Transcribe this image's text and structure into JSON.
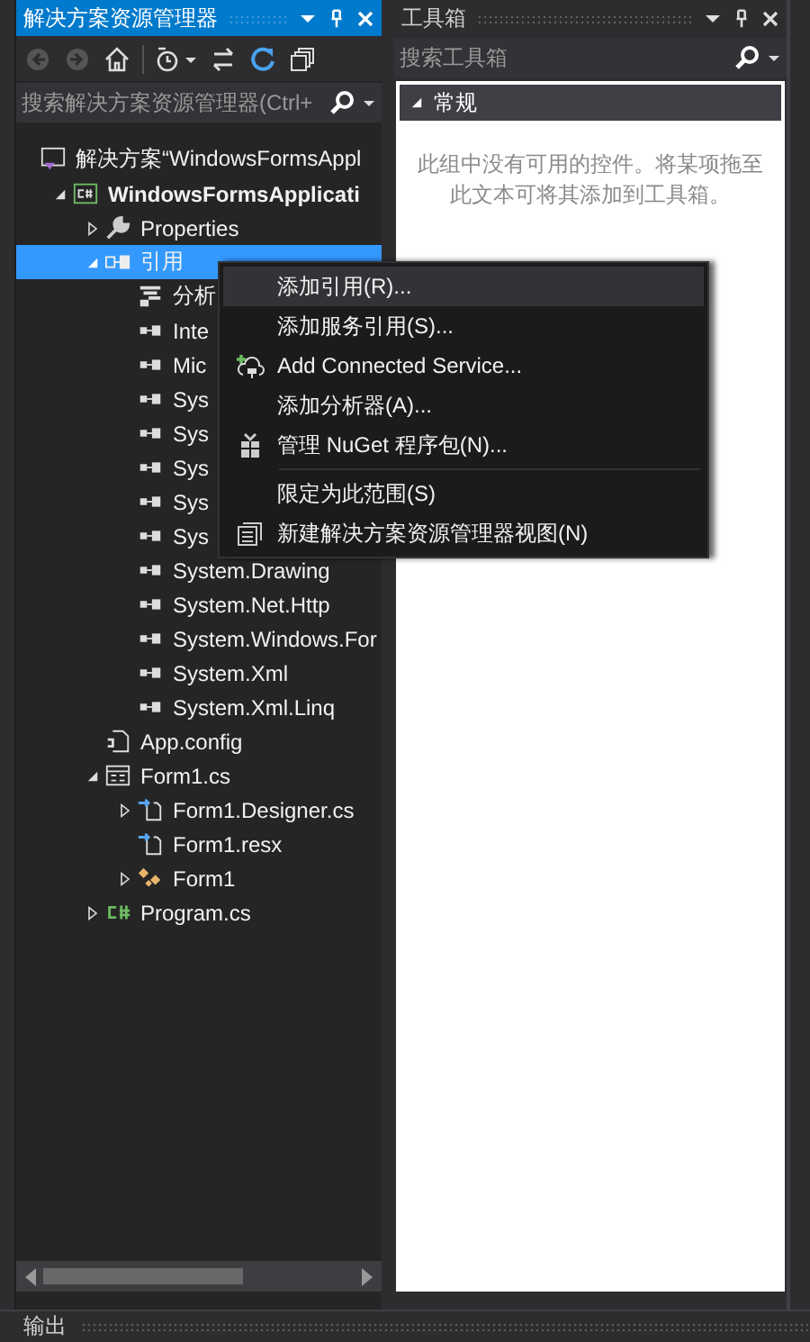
{
  "solution_explorer": {
    "title": "解决方案资源管理器",
    "search": {
      "placeholder": "搜索解决方案资源管理器(Ctrl+"
    },
    "tree": [
      {
        "label": "解决方案“WindowsFormsAppl",
        "kind": "solution",
        "selected": false,
        "children": [
          {
            "label": "WindowsFormsApplicati",
            "kind": "project",
            "expanded": true,
            "selected": false,
            "children": [
              {
                "label": "Properties",
                "kind": "properties",
                "expanded": false,
                "selected": false
              },
              {
                "label": "引用",
                "kind": "references",
                "expanded": true,
                "selected": true,
                "children": [
                  {
                    "label": "分析",
                    "kind": "analyzer",
                    "selected": false
                  },
                  {
                    "label": "Inte",
                    "kind": "assembly",
                    "selected": false
                  },
                  {
                    "label": "Mic",
                    "kind": "assembly",
                    "selected": false
                  },
                  {
                    "label": "Sys",
                    "kind": "assembly",
                    "selected": false
                  },
                  {
                    "label": "Sys",
                    "kind": "assembly",
                    "selected": false
                  },
                  {
                    "label": "Sys",
                    "kind": "assembly",
                    "selected": false
                  },
                  {
                    "label": "Sys",
                    "kind": "assembly",
                    "selected": false
                  },
                  {
                    "label": "Sys",
                    "kind": "assembly",
                    "selected": false
                  },
                  {
                    "label": "System.Drawing",
                    "kind": "assembly",
                    "selected": false
                  },
                  {
                    "label": "System.Net.Http",
                    "kind": "assembly",
                    "selected": false
                  },
                  {
                    "label": "System.Windows.For",
                    "kind": "assembly",
                    "selected": false
                  },
                  {
                    "label": "System.Xml",
                    "kind": "assembly",
                    "selected": false
                  },
                  {
                    "label": "System.Xml.Linq",
                    "kind": "assembly",
                    "selected": false
                  }
                ]
              },
              {
                "label": "App.config",
                "kind": "config",
                "selected": false
              },
              {
                "label": "Form1.cs",
                "kind": "form",
                "expanded": true,
                "selected": false,
                "children": [
                  {
                    "label": "Form1.Designer.cs",
                    "kind": "code",
                    "expanded": false,
                    "selected": false
                  },
                  {
                    "label": "Form1.resx",
                    "kind": "code",
                    "selected": false
                  },
                  {
                    "label": "Form1",
                    "kind": "class",
                    "expanded": false,
                    "selected": false
                  }
                ]
              },
              {
                "label": "Program.cs",
                "kind": "csharp",
                "expanded": false,
                "selected": false
              }
            ]
          }
        ]
      }
    ]
  },
  "context_menu": [
    {
      "kind": "plain",
      "label": "添加引用(R)...",
      "selected": true
    },
    {
      "kind": "plain",
      "label": "添加服务引用(S)...",
      "selected": false
    },
    {
      "kind": "connect",
      "label": "Add Connected Service...",
      "selected": false
    },
    {
      "kind": "plain",
      "label": "添加分析器(A)...",
      "selected": false
    },
    {
      "kind": "package",
      "label": "管理 NuGet 程序包(N)...",
      "selected": false
    },
    {
      "kind": "separator"
    },
    {
      "kind": "plain",
      "label": "限定为此范围(S)",
      "selected": false
    },
    {
      "kind": "view",
      "label": "新建解决方案资源管理器视图(N)",
      "selected": false
    }
  ],
  "toolbox": {
    "title": "工具箱",
    "search": {
      "placeholder": "搜索工具箱"
    },
    "groups": [
      {
        "label": "常规",
        "expanded": true,
        "empty_message": "此组中没有可用的控件。将某项拖至此文本可将其添加到工具箱。"
      }
    ]
  },
  "output_tab": {
    "label": "输出"
  }
}
